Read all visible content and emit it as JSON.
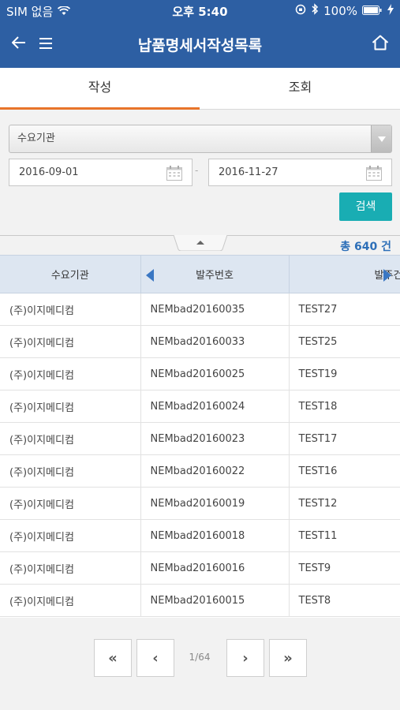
{
  "status": {
    "carrier": "SIM 없음",
    "time": "오후 5:40",
    "battery": "100%"
  },
  "header": {
    "title": "납품명세서작성목록",
    "back_icon": "arrow-left-icon",
    "menu_icon": "hamburger-menu-icon",
    "home_icon": "home-icon"
  },
  "tabs": [
    {
      "label": "작성",
      "active": true
    },
    {
      "label": "조회",
      "active": false
    }
  ],
  "filter": {
    "agency_select": "수요기관",
    "date_from": "2016-09-01",
    "date_to": "2016-11-27",
    "date_separator": "-",
    "search_label": "검색"
  },
  "total": "총 640 건",
  "table": {
    "columns": [
      "수요기관",
      "발주번호",
      "발주건"
    ],
    "rows": [
      [
        "(주)이지메디컴",
        "NEMbad20160035",
        "TEST27"
      ],
      [
        "(주)이지메디컴",
        "NEMbad20160033",
        "TEST25"
      ],
      [
        "(주)이지메디컴",
        "NEMbad20160025",
        "TEST19"
      ],
      [
        "(주)이지메디컴",
        "NEMbad20160024",
        "TEST18"
      ],
      [
        "(주)이지메디컴",
        "NEMbad20160023",
        "TEST17"
      ],
      [
        "(주)이지메디컴",
        "NEMbad20160022",
        "TEST16"
      ],
      [
        "(주)이지메디컴",
        "NEMbad20160019",
        "TEST12"
      ],
      [
        "(주)이지메디컴",
        "NEMbad20160018",
        "TEST11"
      ],
      [
        "(주)이지메디컴",
        "NEMbad20160016",
        "TEST9"
      ],
      [
        "(주)이지메디컴",
        "NEMbad20160015",
        "TEST8"
      ]
    ]
  },
  "pager": {
    "first": "«",
    "prev": "‹",
    "info": "1/64",
    "next": "›",
    "last": "»"
  },
  "colors": {
    "header_bg": "#2d5fa3",
    "tab_active": "#e8742a",
    "search_btn": "#19adb3",
    "total_text": "#2d6fb8"
  }
}
